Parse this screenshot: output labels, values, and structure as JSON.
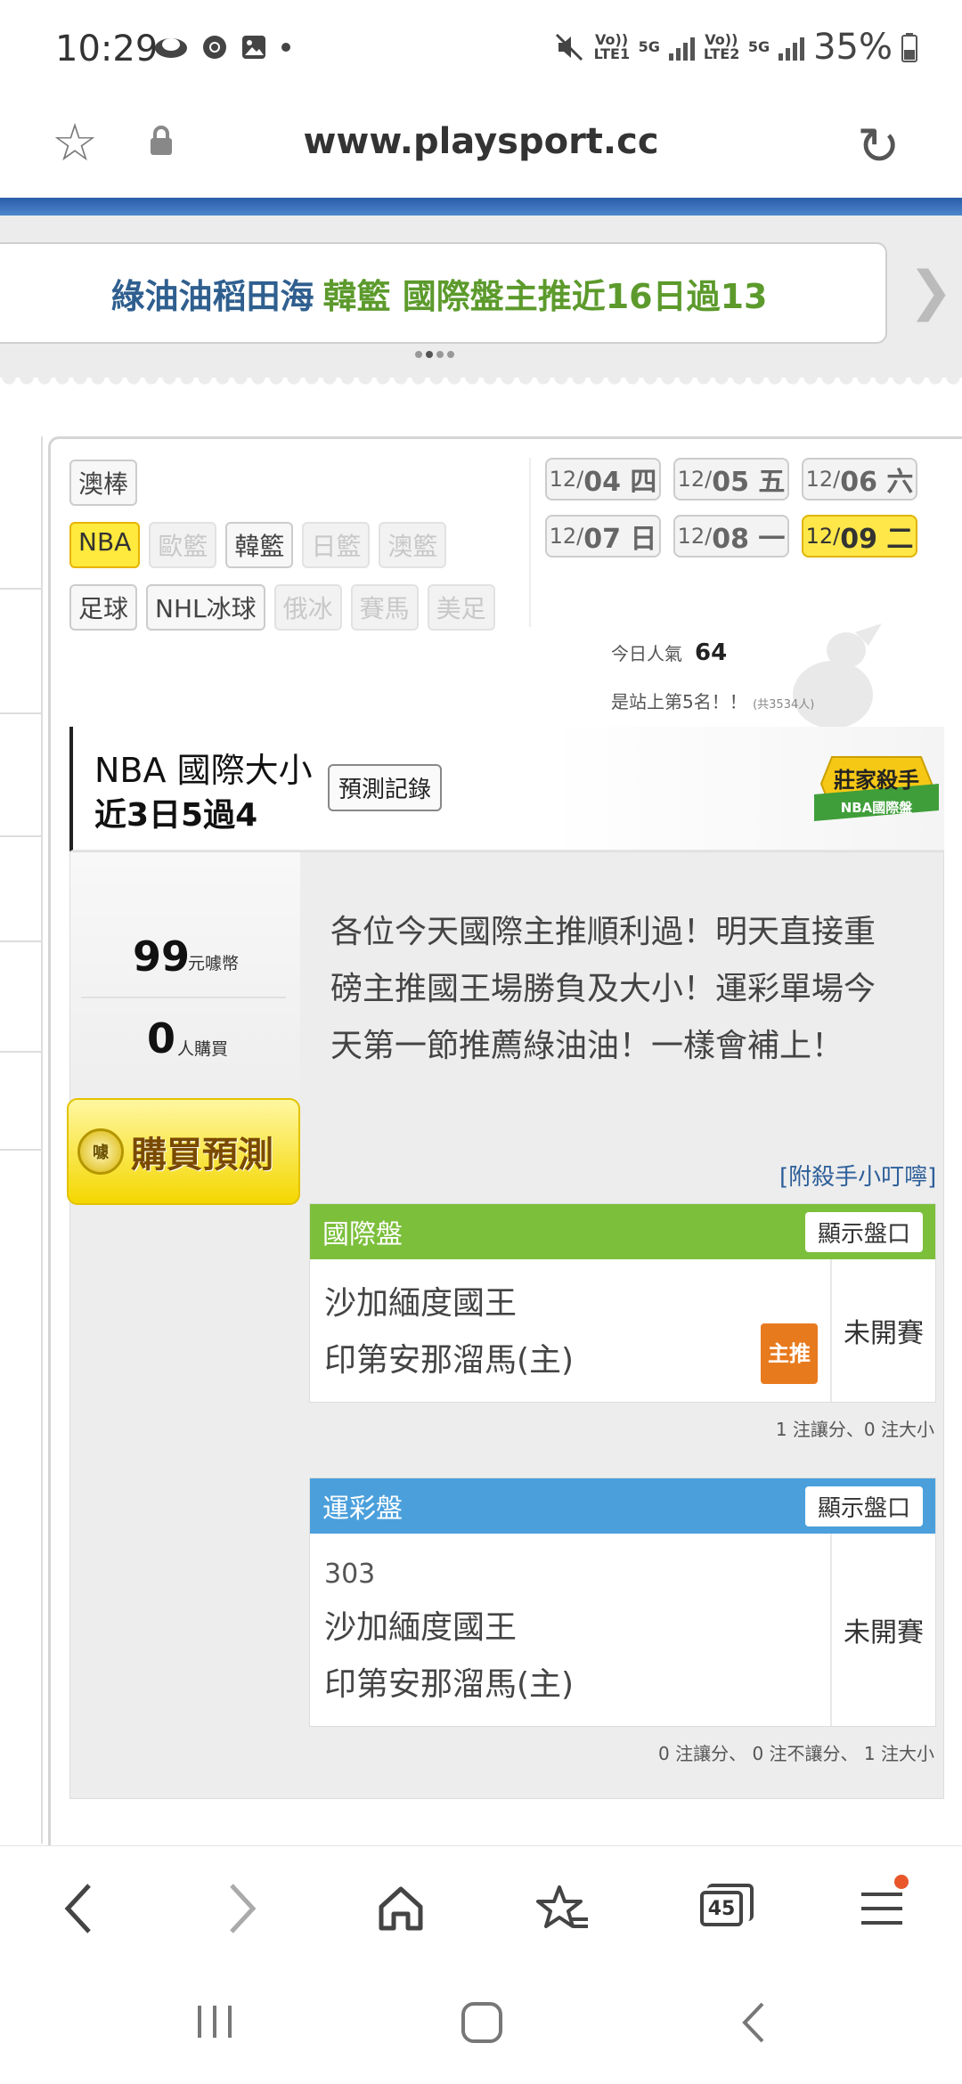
{
  "status_bar": {
    "time": "10:29",
    "volte1": "Vo)) LTE1",
    "volte2": "Vo)) LTE2",
    "network1": "5G",
    "network2": "5G",
    "battery": "35%"
  },
  "browser": {
    "url": "www.playsport.cc",
    "tab_count": "45"
  },
  "promo": {
    "part1": "綠油油稻田海",
    "part2": "韓籃 國際盤主推近16日過13"
  },
  "sports": {
    "row1": [
      "澳棒"
    ],
    "row2": [
      "NBA",
      "歐籃",
      "韓籃",
      "日籃",
      "澳籃"
    ],
    "row3": [
      "足球",
      "NHL冰球",
      "俄冰",
      "賽馬",
      "美足"
    ]
  },
  "dates": [
    {
      "month": "12/",
      "day": "04 四"
    },
    {
      "month": "12/",
      "day": "05 五"
    },
    {
      "month": "12/",
      "day": "06 六"
    },
    {
      "month": "12/",
      "day": "07 日"
    },
    {
      "month": "12/",
      "day": "08 一"
    },
    {
      "month": "12/",
      "day": "09 二"
    }
  ],
  "popularity": {
    "label": "今日人氣",
    "value": "64",
    "rank": "是站上第5名！！",
    "total": "(共3534人)"
  },
  "killer": {
    "title": "NBA 國際大小",
    "record": "近3日5過4",
    "history_button": "預測記錄",
    "badge_line1": "莊家殺手",
    "badge_line2": "NBA國際盤"
  },
  "price": {
    "amount": "99",
    "unit": "元噱幣",
    "buyers": "0",
    "buyers_unit": "人購買",
    "buy_button": "購買預測",
    "coin_label": "噱"
  },
  "message": "各位今天國際主推順利過！明天直接重磅主推國王場勝負及大小！運彩單場今天第一節推薦綠油油！一樣會補上！",
  "tips_link": "[附殺手小叮嚀]",
  "cards": [
    {
      "header": "國際盤",
      "show_button": "顯示盤口",
      "code": "",
      "team1": "沙加緬度國王",
      "team2": "印第安那溜馬(主)",
      "badge": "主推",
      "status": "未開賽",
      "note": "1 注讓分、0 注大小"
    },
    {
      "header": "運彩盤",
      "show_button": "顯示盤口",
      "code": "303",
      "team1": "沙加緬度國王",
      "team2": "印第安那溜馬(主)",
      "badge": "",
      "status": "未開賽",
      "note": "0 注讓分、 0 注不讓分、 1 注大小"
    }
  ],
  "colors": {
    "accent_blue": "#2a5ea8",
    "intl_green": "#7cbf3b",
    "lottery_blue": "#4ba0dc",
    "active_yellow": "#ffe74a",
    "badge_orange": "#e87a1e"
  }
}
